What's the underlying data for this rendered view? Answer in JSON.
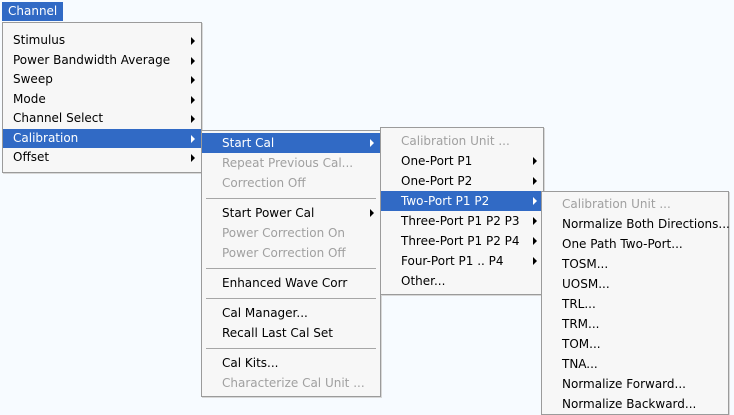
{
  "menubar": {
    "channel": "Channel"
  },
  "channel_menu": {
    "items": [
      {
        "label": "Stimulus"
      },
      {
        "label": "Power Bandwidth Average"
      },
      {
        "label": "Sweep"
      },
      {
        "label": "Mode"
      },
      {
        "label": "Channel Select"
      },
      {
        "label": "Calibration"
      },
      {
        "label": "Offset"
      }
    ]
  },
  "calibration_menu": {
    "start_cal": "Start Cal",
    "repeat_previous_cal": "Repeat Previous Cal...",
    "correction_off": "Correction Off",
    "start_power_cal": "Start Power Cal",
    "power_correction_on": "Power Correction On",
    "power_correction_off": "Power Correction Off",
    "enhanced_wave_corr": "Enhanced Wave Corr",
    "cal_manager": "Cal Manager...",
    "recall_last_cal_set": "Recall Last Cal Set",
    "cal_kits": "Cal Kits...",
    "characterize_cal_unit": "Characterize Cal Unit ..."
  },
  "start_cal_menu": {
    "items": [
      {
        "label": "Calibration Unit ..."
      },
      {
        "label": "One-Port P1"
      },
      {
        "label": "One-Port P2"
      },
      {
        "label": "Two-Port P1 P2"
      },
      {
        "label": "Three-Port P1 P2 P3"
      },
      {
        "label": "Three-Port P1 P2 P4"
      },
      {
        "label": "Four-Port P1 .. P4"
      },
      {
        "label": "Other..."
      }
    ]
  },
  "two_port_menu": {
    "items": [
      {
        "label": "Calibration Unit ..."
      },
      {
        "label": "Normalize Both Directions..."
      },
      {
        "label": "One Path Two-Port..."
      },
      {
        "label": "TOSM..."
      },
      {
        "label": "UOSM..."
      },
      {
        "label": "TRL..."
      },
      {
        "label": "TRM..."
      },
      {
        "label": "TOM..."
      },
      {
        "label": "TNA..."
      },
      {
        "label": "Normalize Forward..."
      },
      {
        "label": "Normalize Backward..."
      }
    ]
  },
  "colors": {
    "selection": "#316ac5",
    "menu_background": "#f7f7f7",
    "disabled_text": "#a0a0a0",
    "page_background": "#f7fbff"
  }
}
